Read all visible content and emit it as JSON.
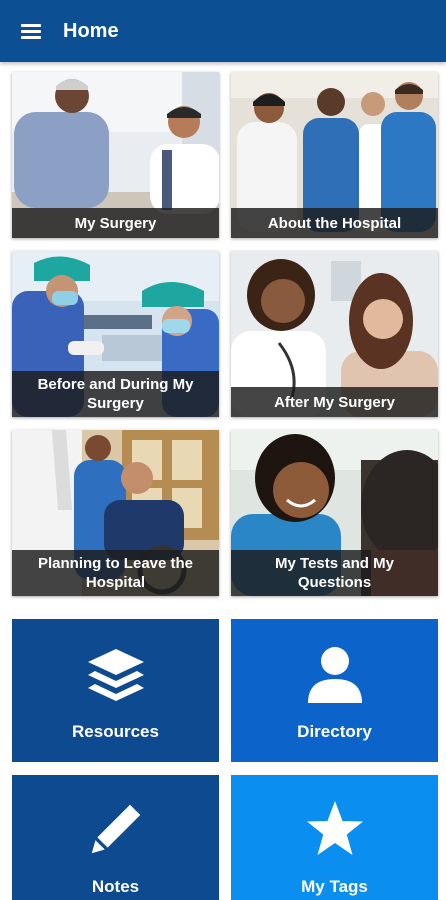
{
  "header": {
    "title": "Home",
    "menu_icon": "hamburger-menu-icon"
  },
  "photo_tiles": [
    {
      "label": "My Surgery"
    },
    {
      "label": "About the Hospital"
    },
    {
      "label": "Before and During My Surgery"
    },
    {
      "label": "After My Surgery"
    },
    {
      "label": "Planning to Leave the Hospital"
    },
    {
      "label": "My Tests and My Questions"
    }
  ],
  "menu_tiles": [
    {
      "label": "Resources",
      "icon": "layers-icon",
      "color": "#0e4a8f"
    },
    {
      "label": "Directory",
      "icon": "person-icon",
      "color": "#0c63c9"
    },
    {
      "label": "Notes",
      "icon": "pencil-icon",
      "color": "#0e4a8f"
    },
    {
      "label": "My Tags",
      "icon": "star-icon",
      "color": "#0a8ff0"
    }
  ],
  "colors": {
    "app_bar": "#0d4f93",
    "caption_bg": "#1c1c1c"
  }
}
